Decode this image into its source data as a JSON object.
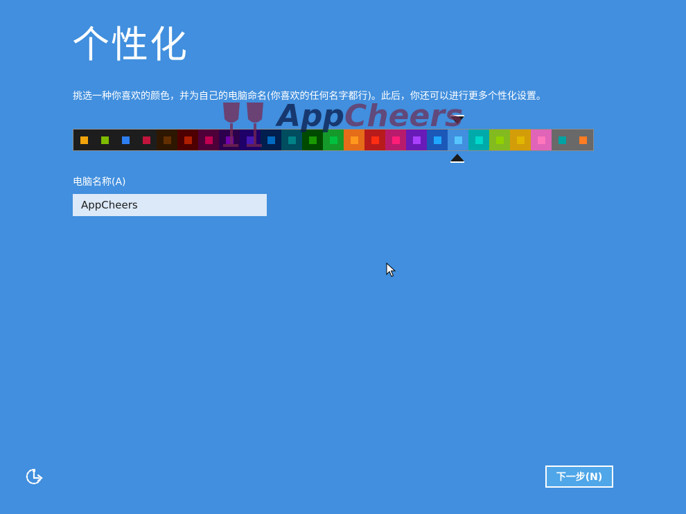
{
  "header": {
    "title": "个性化",
    "description": "挑选一种你喜欢的颜色，并为自己的电脑命名(你喜欢的任何名字都行)。此后，你还可以进行更多个性化设置。"
  },
  "watermark": {
    "brand_part1": "App",
    "brand_part2": "Cheers"
  },
  "palette": {
    "selected_index": 18,
    "swatches": [
      {
        "bg": "#1d1d1d",
        "chip": "#f0a30a"
      },
      {
        "bg": "#1d1d1d",
        "chip": "#7dba00"
      },
      {
        "bg": "#1d1d1d",
        "chip": "#2d7ef0"
      },
      {
        "bg": "#1d1d1d",
        "chip": "#c0143c"
      },
      {
        "bg": "#2e1700",
        "chip": "#632f00"
      },
      {
        "bg": "#4e0000",
        "chip": "#b01e00"
      },
      {
        "bg": "#4e0038",
        "chip": "#c1004f"
      },
      {
        "bg": "#2d004e",
        "chip": "#7200ac"
      },
      {
        "bg": "#1f0068",
        "chip": "#4617b4"
      },
      {
        "bg": "#001e4e",
        "chip": "#006ac1"
      },
      {
        "bg": "#004d60",
        "chip": "#008287"
      },
      {
        "bg": "#004a00",
        "chip": "#199900"
      },
      {
        "bg": "#15992a",
        "chip": "#00c13f"
      },
      {
        "bg": "#e56c19",
        "chip": "#ff981d"
      },
      {
        "bg": "#b81b1b",
        "chip": "#ff2e12"
      },
      {
        "bg": "#b81b6c",
        "chip": "#ff1d77"
      },
      {
        "bg": "#691bb8",
        "chip": "#aa40ff"
      },
      {
        "bg": "#1b58b8",
        "chip": "#1fa7ff"
      },
      {
        "bg": "#418fde",
        "chip": "#56c5ff"
      },
      {
        "bg": "#00aaaa",
        "chip": "#00d8cc"
      },
      {
        "bg": "#83ba1f",
        "chip": "#91d100"
      },
      {
        "bg": "#d39d09",
        "chip": "#e1b700"
      },
      {
        "bg": "#e064b7",
        "chip": "#ff76bc"
      },
      {
        "bg": "#696969",
        "chip": "#00a3a3"
      },
      {
        "bg": "#696969",
        "chip": "#fe7c22"
      }
    ]
  },
  "computer_name": {
    "label": "电脑名称(A)",
    "value": "AppCheers"
  },
  "footer": {
    "ease_of_access_icon": "ease-of-access-icon",
    "next_label": "下一步(N)"
  },
  "colors": {
    "background": "#418fde",
    "input_background": "#dce9f8",
    "button_background": "#4fa6e8"
  }
}
